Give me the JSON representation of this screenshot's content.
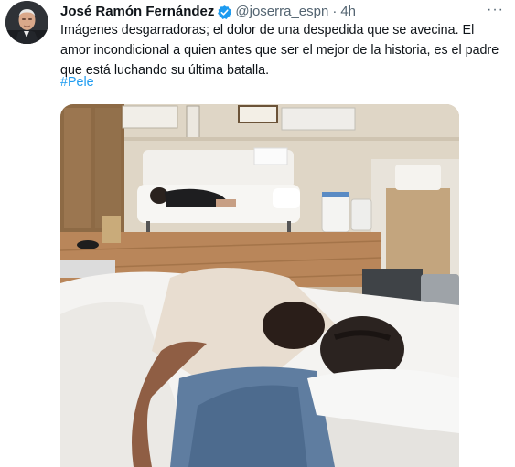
{
  "tweet": {
    "author": {
      "name": "José Ramón Fernández",
      "handle": "@joserra_espn",
      "verified_icon": "verified-badge-icon"
    },
    "separator": "·",
    "timestamp": "4h",
    "more_icon": "more-options-icon",
    "more_label": "···",
    "text": "Imágenes desgarradoras; el dolor de una despedida que se avecina. El amor incondicional a quien antes que ser el mejor de la historia, es el padre que está luchando su última batalla.",
    "hashtag": "#Pele",
    "media": {
      "type": "photo"
    }
  },
  "colors": {
    "text": "#0f1419",
    "secondary": "#536471",
    "link": "#1d9bf0",
    "verified": "#1d9bf0"
  }
}
